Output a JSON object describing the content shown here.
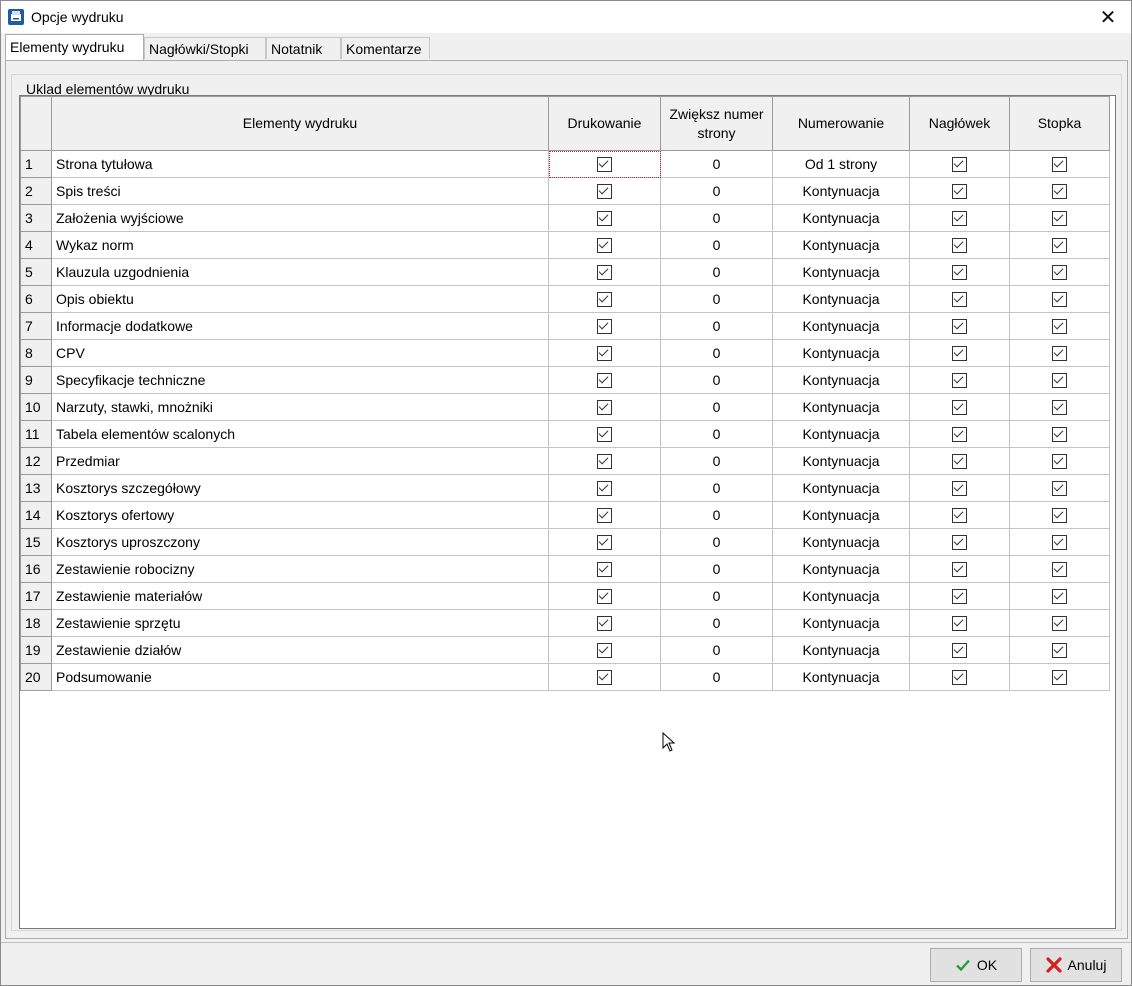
{
  "window": {
    "title": "Opcje wydruku",
    "close_label": "✕"
  },
  "tabs": [
    {
      "label": "Elementy wydruku",
      "active": true
    },
    {
      "label": "Nagłówki/Stopki",
      "active": false
    },
    {
      "label": "Notatnik",
      "active": false
    },
    {
      "label": "Komentarze",
      "active": false
    }
  ],
  "group": {
    "label": "Uklad elementów wydruku"
  },
  "table": {
    "columns": [
      "Elementy wydruku",
      "Drukowanie",
      "Zwiększ numer strony",
      "Numerowanie",
      "Nagłówek",
      "Stopka"
    ],
    "rows": [
      {
        "num": "1",
        "name": "Strona tytułowa",
        "print": true,
        "increase": "0",
        "numbering": "Od 1 strony",
        "header": true,
        "footer": true
      },
      {
        "num": "2",
        "name": "Spis treści",
        "print": true,
        "increase": "0",
        "numbering": "Kontynuacja",
        "header": true,
        "footer": true
      },
      {
        "num": "3",
        "name": "Założenia wyjściowe",
        "print": true,
        "increase": "0",
        "numbering": "Kontynuacja",
        "header": true,
        "footer": true
      },
      {
        "num": "4",
        "name": "Wykaz norm",
        "print": true,
        "increase": "0",
        "numbering": "Kontynuacja",
        "header": true,
        "footer": true
      },
      {
        "num": "5",
        "name": "Klauzula uzgodnienia",
        "print": true,
        "increase": "0",
        "numbering": "Kontynuacja",
        "header": true,
        "footer": true
      },
      {
        "num": "6",
        "name": "Opis obiektu",
        "print": true,
        "increase": "0",
        "numbering": "Kontynuacja",
        "header": true,
        "footer": true
      },
      {
        "num": "7",
        "name": "Informacje dodatkowe",
        "print": true,
        "increase": "0",
        "numbering": "Kontynuacja",
        "header": true,
        "footer": true
      },
      {
        "num": "8",
        "name": "CPV",
        "print": true,
        "increase": "0",
        "numbering": "Kontynuacja",
        "header": true,
        "footer": true
      },
      {
        "num": "9",
        "name": "Specyfikacje techniczne",
        "print": true,
        "increase": "0",
        "numbering": "Kontynuacja",
        "header": true,
        "footer": true
      },
      {
        "num": "10",
        "name": "Narzuty, stawki, mnożniki",
        "print": true,
        "increase": "0",
        "numbering": "Kontynuacja",
        "header": true,
        "footer": true
      },
      {
        "num": "11",
        "name": "Tabela elementów scalonych",
        "print": true,
        "increase": "0",
        "numbering": "Kontynuacja",
        "header": true,
        "footer": true
      },
      {
        "num": "12",
        "name": "Przedmiar",
        "print": true,
        "increase": "0",
        "numbering": "Kontynuacja",
        "header": true,
        "footer": true
      },
      {
        "num": "13",
        "name": "Kosztorys szczegółowy",
        "print": true,
        "increase": "0",
        "numbering": "Kontynuacja",
        "header": true,
        "footer": true
      },
      {
        "num": "14",
        "name": "Kosztorys ofertowy",
        "print": true,
        "increase": "0",
        "numbering": "Kontynuacja",
        "header": true,
        "footer": true
      },
      {
        "num": "15",
        "name": "Kosztorys uproszczony",
        "print": true,
        "increase": "0",
        "numbering": "Kontynuacja",
        "header": true,
        "footer": true
      },
      {
        "num": "16",
        "name": "Zestawienie robocizny",
        "print": true,
        "increase": "0",
        "numbering": "Kontynuacja",
        "header": true,
        "footer": true
      },
      {
        "num": "17",
        "name": "Zestawienie materiałów",
        "print": true,
        "increase": "0",
        "numbering": "Kontynuacja",
        "header": true,
        "footer": true
      },
      {
        "num": "18",
        "name": "Zestawienie sprzętu",
        "print": true,
        "increase": "0",
        "numbering": "Kontynuacja",
        "header": true,
        "footer": true
      },
      {
        "num": "19",
        "name": "Zestawienie działów",
        "print": true,
        "increase": "0",
        "numbering": "Kontynuacja",
        "header": true,
        "footer": true
      },
      {
        "num": "20",
        "name": "Podsumowanie",
        "print": true,
        "increase": "0",
        "numbering": "Kontynuacja",
        "header": true,
        "footer": true
      }
    ]
  },
  "buttons": {
    "ok_label": "OK",
    "cancel_label": "Anuluj"
  },
  "colors": {
    "ok_check": "#2e9b3a",
    "cancel_x": "#d42020",
    "focus_outline": "#b03030"
  }
}
